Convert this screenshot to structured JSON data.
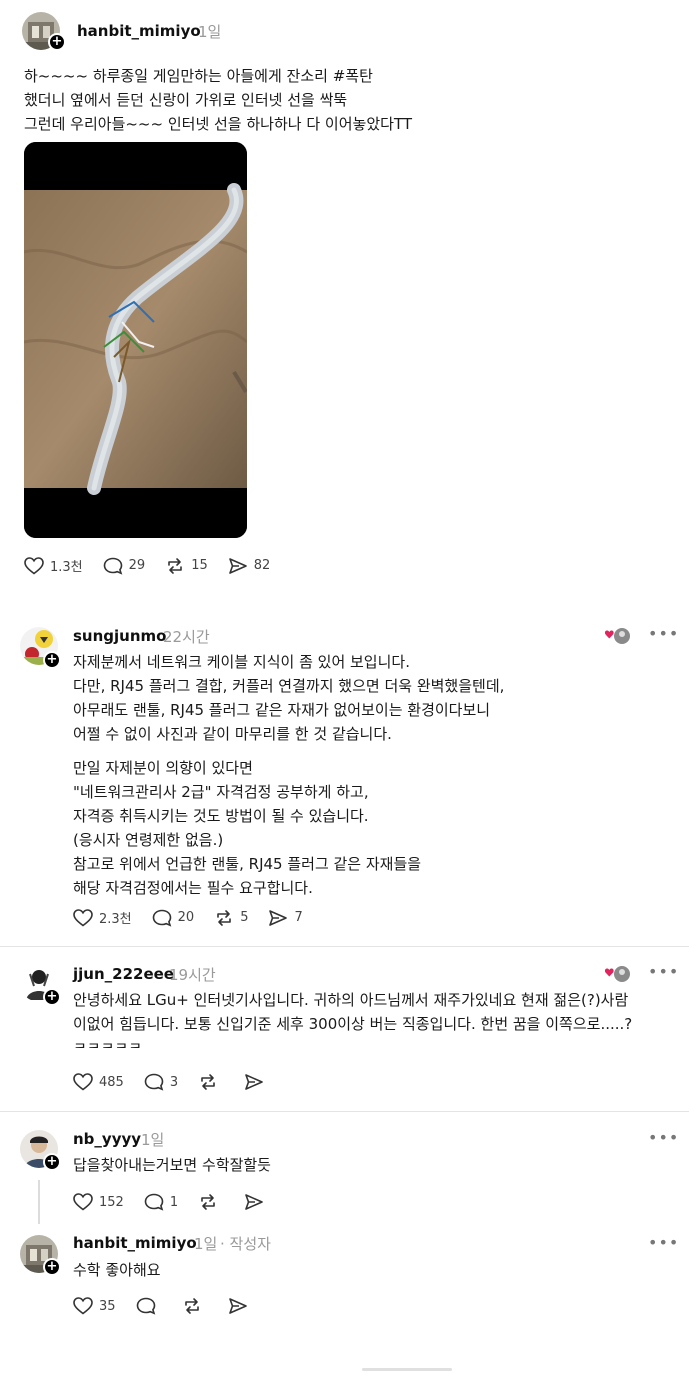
{
  "post": {
    "username": "hanbit_mimiyo",
    "time": "1일",
    "text": "하~~~~ 하루종일 게임만하는 아들에게 잔소리 #폭탄\n했더니 옆에서 듣던 신랑이 가위로 인터넷 선을 싹뚝\n그런데 우리아들~~~ 인터넷 선을 하나하나 다 이어놓았다TT",
    "likes": "1.3천",
    "comments": "29",
    "reposts": "15",
    "shares": "82"
  },
  "replies": [
    {
      "username": "sungjunmo",
      "time": "22시간",
      "text": "자제분께서 네트워크 케이블 지식이 좀 있어 보입니다.\n다만, RJ45 플러그 결합, 커플러 연결까지 했으면 더욱 완벽했을텐데,\n아무래도 랜툴, RJ45 플러그 같은 자재가 없어보이는 환경이다보니\n어쩔 수 없이 사진과 같이 마무리를 한 것 같습니다.",
      "text2": "만일 자제분이 의향이 있다면\n\"네트워크관리사 2급\" 자격검정 공부하게 하고,\n자격증 취득시키는 것도 방법이 될 수 있습니다.\n(응시자 연령제한 없음.)\n참고로 위에서 언급한 랜툴, RJ45 플러그 같은 자재들을\n해당 자격검정에서는 필수 요구합니다.",
      "likes": "2.3천",
      "comments": "20",
      "reposts": "5",
      "shares": "7"
    },
    {
      "username": "jjun_222eee",
      "time": "19시간",
      "text": "안녕하세요 LGu+ 인터넷기사입니다. 귀하의 아드님께서 재주가있네요 현재 젊은(?)사람\n이없어 힘듭니다. 보통 신입기준 세후 300이상 버는 직종입니다. 한번 꿈을 이쪽으로.....?\nㅋㅋㅋㅋㅋ",
      "likes": "485",
      "comments": "3"
    },
    {
      "username": "nb_yyyy",
      "time": "1일",
      "text": "답을찾아내는거보면 수학잘할듯",
      "likes": "152",
      "comments": "1"
    },
    {
      "username": "hanbit_mimiyo",
      "time": "1일",
      "author_label": "· 작성자",
      "text": "수학 좋아해요",
      "likes": "35"
    }
  ],
  "icons": {
    "more": "more-icon",
    "like": "heart-icon",
    "comment": "comment-icon",
    "repost": "repost-icon",
    "share": "share-icon",
    "follow": "plus-icon"
  },
  "colors": {
    "liked_heart": "#e0245e",
    "secondary_text": "#9a9a9a"
  }
}
